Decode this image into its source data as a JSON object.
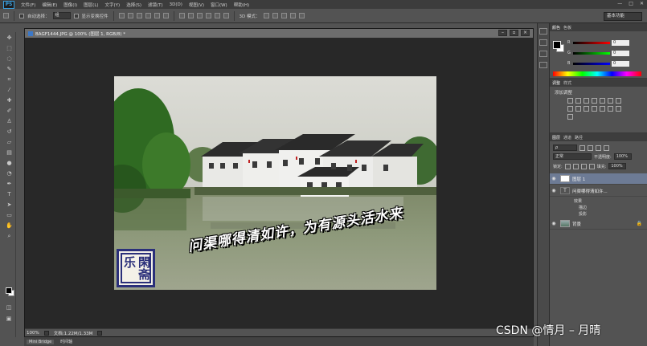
{
  "menubar": {
    "logo": "PS",
    "items": [
      "文件(F)",
      "编辑(E)",
      "图像(I)",
      "图层(L)",
      "文字(Y)",
      "选择(S)",
      "滤镜(T)",
      "3D(D)",
      "视图(V)",
      "窗口(W)",
      "帮助(H)"
    ],
    "win_controls": [
      "—",
      "□",
      "✕"
    ]
  },
  "options_bar": {
    "auto_select_label": "自动选择：",
    "auto_select_value": "组",
    "show_transform_label": "显示变换控件",
    "mode_3d_label": "3D 模式：",
    "workspace": "基本功能"
  },
  "document": {
    "title": "BAGF1444.JPG @ 100% (图层 1, RGB/8) *",
    "zoom": "100%",
    "doc_info": "文档:1.22M/1.33M",
    "poem": "问渠哪得清如许，为有源头活水来",
    "seal_a": "乐",
    "seal_b": "閑斋"
  },
  "color_panel": {
    "tabs": [
      "颜色",
      "色板"
    ],
    "channels": [
      {
        "label": "R",
        "value": "0"
      },
      {
        "label": "G",
        "value": "0"
      },
      {
        "label": "B",
        "value": "0"
      }
    ]
  },
  "adjust_panel": {
    "tabs": [
      "调整",
      "样式"
    ],
    "label": "添加调整"
  },
  "layers_panel": {
    "tabs": [
      "图层",
      "通道",
      "路径"
    ],
    "blend_mode": "正常",
    "opacity_label": "不透明度:",
    "opacity": "100%",
    "lock_label": "锁定:",
    "fill_label": "填充:",
    "fill": "100%",
    "layers": [
      {
        "name": "图层 1",
        "selected": true,
        "thumb": "white"
      },
      {
        "name": "问渠哪得清如许...",
        "selected": false,
        "thumb": "text"
      },
      {
        "name": "背景",
        "selected": false,
        "thumb": "img"
      }
    ],
    "effects_label": "效果",
    "effects": [
      "描边",
      "投影"
    ]
  },
  "bottom": {
    "mini_bridge": "Mini Bridge",
    "timeline": "时间轴"
  },
  "watermark": "CSDN @情月 – 月晴"
}
